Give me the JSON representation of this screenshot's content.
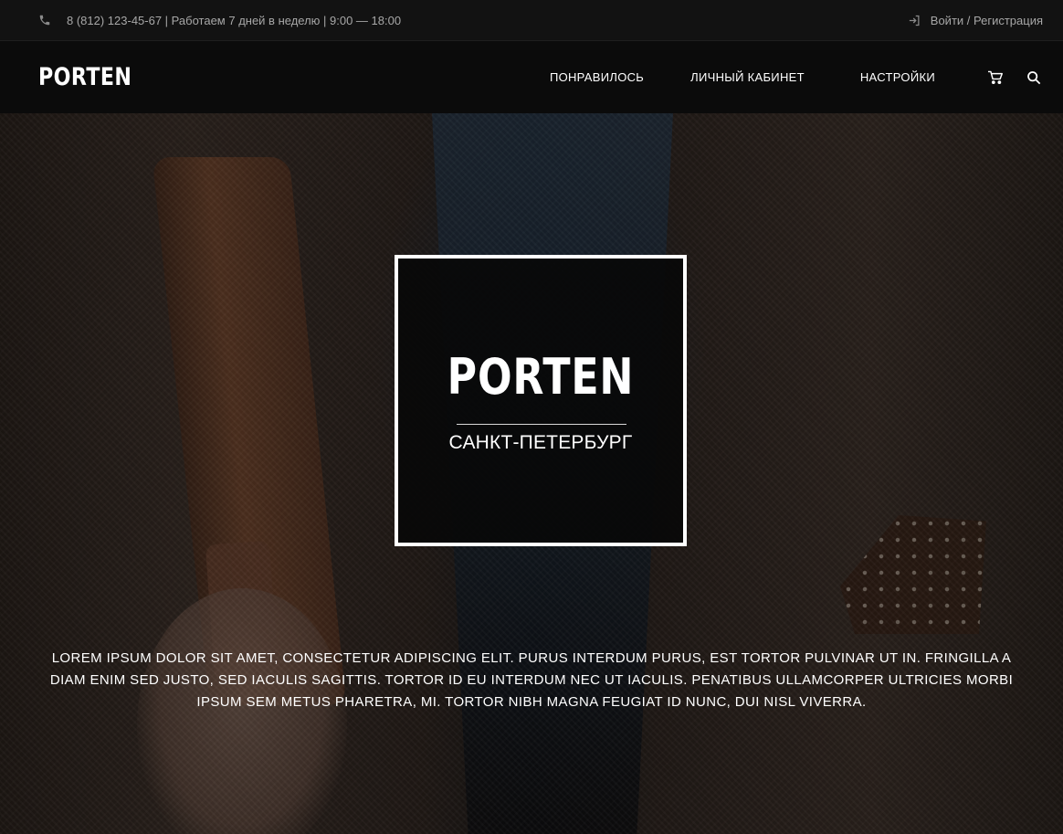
{
  "topbar": {
    "contact": "8 (812) 123-45-67 | Работаем 7 дней в неделю | 9:00 — 18:00",
    "auth_link": "Войти / Регистрация",
    "phone_icon": "phone-icon",
    "login_icon": "login-icon"
  },
  "header": {
    "logo": "PORTEN",
    "nav": {
      "liked": "ПОНРАВИЛОСЬ",
      "account": "ЛИЧНЫЙ КАБИНЕТ",
      "settings": "НАСТРОЙКИ"
    },
    "cart_icon": "cart-icon",
    "search_icon": "search-icon"
  },
  "hero": {
    "brand": "PORTEN",
    "city": "САНКТ-ПЕТЕРБУРГ",
    "text": "LOREM IPSUM DOLOR SIT AMET, CONSECTETUR ADIPISCING ELIT. PURUS INTERDUM PURUS, EST TORTOR PULVINAR UT IN. FRINGILLA A DIAM ENIM SED JUSTO, SED IACULIS SAGITTIS. TORTOR ID EU INTERDUM NEC UT IACULIS. PENATIBUS ULLAMCORPER ULTRICIES MORBI IPSUM SEM METUS PHARETRA, MI. TORTOR NIBH MAGNA FEUGIAT ID NUNC, DUI NISL VIVERRA."
  },
  "colors": {
    "topbar_bg": "#121212",
    "header_bg": "#0b0b0b",
    "topbar_text": "#a7a7a7",
    "text": "#ffffff"
  }
}
